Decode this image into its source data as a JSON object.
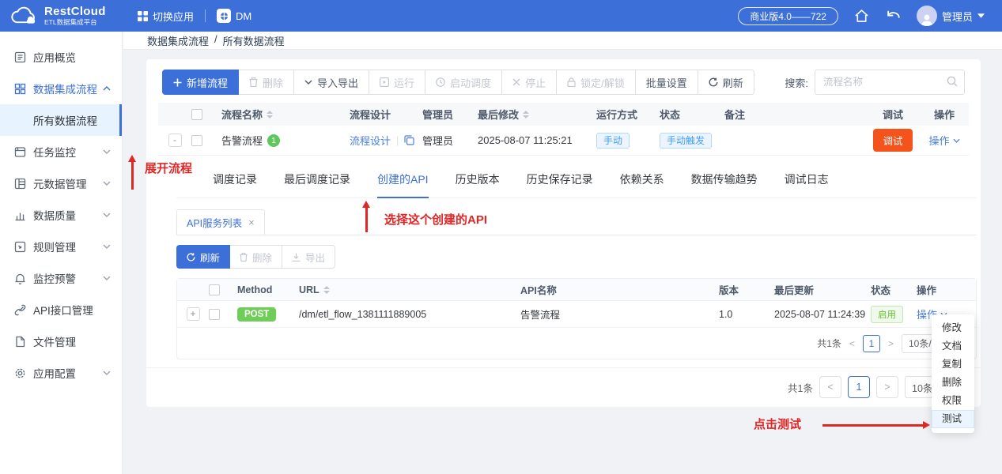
{
  "header": {
    "brand_name": "RestCloud",
    "brand_subtitle": "ETL数据集成平台",
    "switch_app": "切换应用",
    "workspace": "DM",
    "version": "商业版4.0——722",
    "user": "管理员"
  },
  "sidebar": {
    "items": [
      {
        "label": "应用概览"
      },
      {
        "label": "数据集成流程"
      },
      {
        "label": "所有数据流程"
      },
      {
        "label": "任务监控"
      },
      {
        "label": "元数据管理"
      },
      {
        "label": "数据质量"
      },
      {
        "label": "规则管理"
      },
      {
        "label": "监控预警"
      },
      {
        "label": "API接口管理"
      },
      {
        "label": "文件管理"
      },
      {
        "label": "应用配置"
      }
    ]
  },
  "breadcrumb": {
    "parent": "数据集成流程",
    "separator": "/",
    "current": "所有数据流程"
  },
  "toolbar": {
    "new_flow": "新增流程",
    "delete": "删除",
    "import_export": "导入导出",
    "run": "运行",
    "start_schedule": "启动调度",
    "stop": "停止",
    "lock": "锁定/解锁",
    "batch": "批量设置",
    "refresh": "刷新",
    "search_label": "搜索:",
    "search_placeholder": "流程名称"
  },
  "flow_table": {
    "col_name": "流程名称",
    "col_design": "流程设计",
    "col_admin": "管理员",
    "col_modified": "最后修改",
    "col_run_mode": "运行方式",
    "col_status": "状态",
    "col_remark": "备注",
    "col_debug": "调试",
    "col_action": "操作",
    "row": {
      "expand": "-",
      "name": "告警流程",
      "count": "1",
      "design": "流程设计",
      "admin": "管理员",
      "modified": "2025-08-07 11:25:21",
      "run_mode": "手动",
      "status": "手动触发",
      "remark": "",
      "debug": "调试",
      "action": "操作"
    }
  },
  "detail": {
    "tabs": [
      "调度记录",
      "最后调度记录",
      "创建的API",
      "历史版本",
      "历史保存记录",
      "依赖关系",
      "数据传输趋势",
      "调试日志"
    ],
    "active_tab": "创建的API",
    "subtab": "API服务列表",
    "toolbar": {
      "refresh": "刷新",
      "delete": "删除",
      "export": "导出"
    },
    "api_table": {
      "col_method": "Method",
      "col_url": "URL",
      "col_name": "API名称",
      "col_version": "版本",
      "col_updated": "最后更新",
      "col_status": "状态",
      "col_action": "操作",
      "row": {
        "expand": "+",
        "method": "POST",
        "url": "/dm/etl_flow_1381111889005",
        "name": "告警流程",
        "version": "1.0",
        "updated": "2025-08-07 11:24:39",
        "status": "启用",
        "action": "操作"
      }
    },
    "pagination": {
      "total": "共1条",
      "page": "1",
      "page_size": "10条/页"
    }
  },
  "outer_pagination": {
    "total": "共1条",
    "page": "1",
    "page_size": "10条/页"
  },
  "action_menu": {
    "items": [
      "修改",
      "文档",
      "复制",
      "删除",
      "权限",
      "测试"
    ],
    "highlighted": "测试"
  },
  "annotations": {
    "expand_flow": "展开流程",
    "select_api": "选择这个创建的API",
    "click_test": "点击测试"
  },
  "colors": {
    "primary": "#3c6fd8",
    "link": "#4a7fe0",
    "debug_button": "#f4541c",
    "success": "#67c23a",
    "post_badge": "#6fce58",
    "tag_blue": "#409eff",
    "annotation_red": "#e12626"
  }
}
